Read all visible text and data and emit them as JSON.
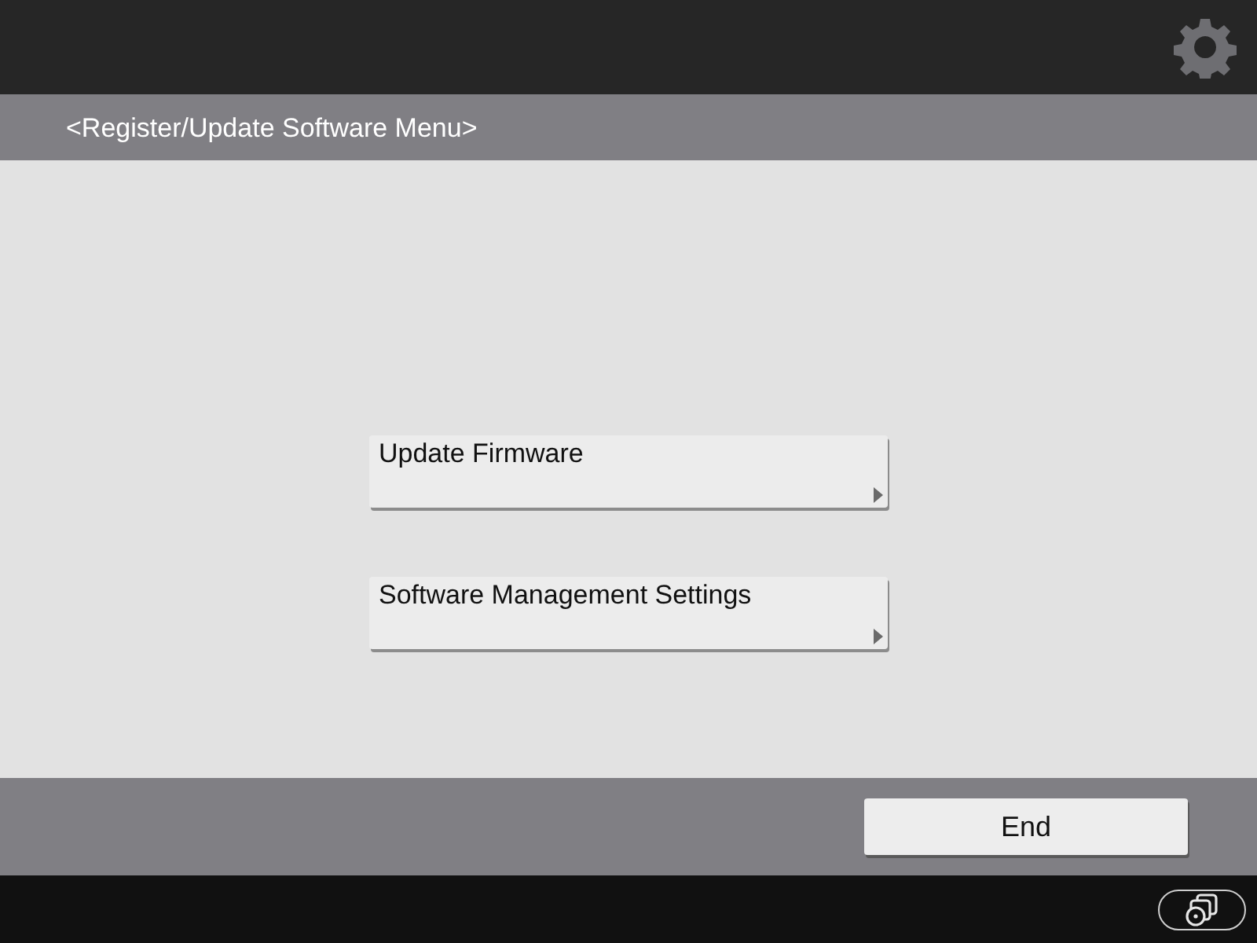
{
  "header": {
    "title": "<Register/Update Software Menu>"
  },
  "menu_items": [
    {
      "label": "Update Firmware"
    },
    {
      "label": "Software Management Settings"
    }
  ],
  "footer": {
    "buttons": [
      "End"
    ]
  }
}
